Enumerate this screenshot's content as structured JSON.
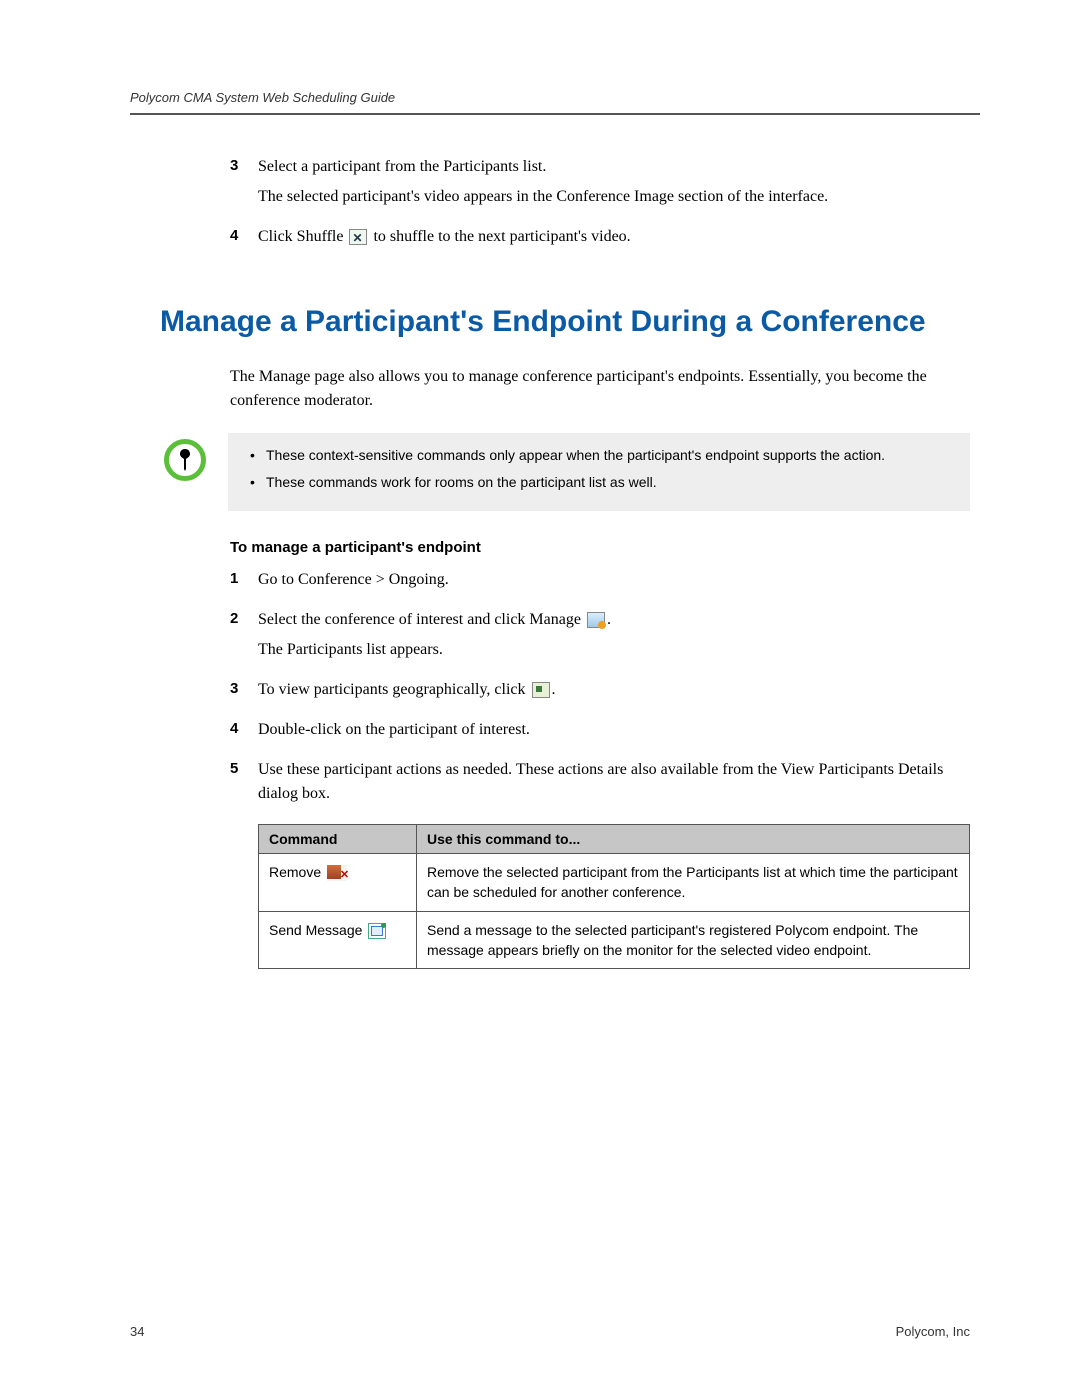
{
  "header": {
    "title": "Polycom CMA System Web Scheduling Guide"
  },
  "top_steps": [
    {
      "num": "3",
      "lines": [
        "Select a participant from the Participants list.",
        "The selected participant's video appears in the Conference Image section of the interface."
      ]
    },
    {
      "num": "4",
      "prefix": "Click Shuffle ",
      "suffix": " to shuffle to the next participant's video."
    }
  ],
  "section_heading": "Manage a Participant's Endpoint During a Conference",
  "intro_para": "The Manage page also allows you to manage conference participant's endpoints. Essentially, you become the conference moderator.",
  "note": {
    "items": [
      "These context-sensitive commands only appear when the participant's endpoint supports the action.",
      "These commands work for rooms on the participant list as well."
    ]
  },
  "subheading": "To manage a participant's endpoint",
  "steps": [
    {
      "num": "1",
      "text": "Go to Conference > Ongoing."
    },
    {
      "num": "2",
      "prefix": "Select the conference of interest and click Manage ",
      "suffix": ".",
      "after": "The Participants list appears."
    },
    {
      "num": "3",
      "prefix": "To view participants geographically, click ",
      "suffix": "."
    },
    {
      "num": "4",
      "text": "Double-click on the participant of interest."
    },
    {
      "num": "5",
      "text": "Use these participant actions as needed. These actions are also available from the View Participants Details dialog box."
    }
  ],
  "table": {
    "headers": [
      "Command",
      "Use this command to..."
    ],
    "rows": [
      {
        "cmd": "Remove",
        "icon": "remove",
        "desc": "Remove the selected participant from the Participants list at which time the participant can be scheduled for another conference."
      },
      {
        "cmd": "Send Message",
        "icon": "message",
        "desc": "Send a message to the selected participant's registered Polycom endpoint. The message appears briefly on the monitor for the selected video endpoint."
      }
    ]
  },
  "footer": {
    "page": "34",
    "company": "Polycom, Inc"
  }
}
